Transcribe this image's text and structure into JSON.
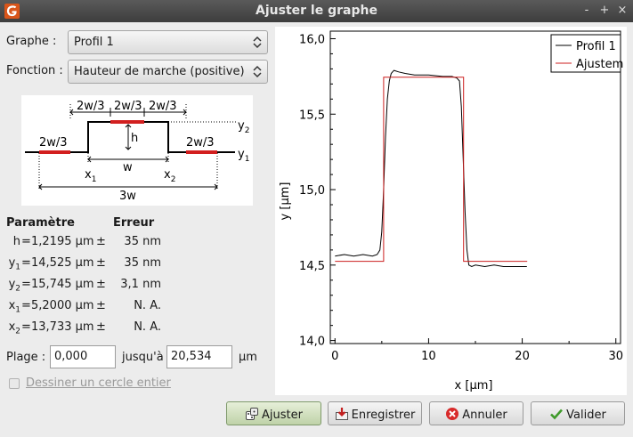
{
  "window": {
    "title": "Ajuster le graphe",
    "controls": [
      "-",
      "+",
      "×"
    ]
  },
  "form": {
    "graph_label": "Graphe :",
    "graph_value": "Profil 1",
    "function_label": "Fonction :",
    "function_value": "Hauteur de marche (positive)"
  },
  "diagram": {
    "labels": {
      "top_left": "2w/3",
      "top_mid": "2w/3",
      "top_right": "2w/3",
      "h": "h",
      "w": "w",
      "left_seg": "2w/3",
      "right_seg": "2w/3",
      "y2": "y",
      "y2_sub": "2",
      "y1": "y",
      "y1_sub": "1",
      "x1": "x",
      "x1_sub": "1",
      "x2": "x",
      "x2_sub": "2",
      "total": "3w"
    },
    "colors": {
      "line": "#000000",
      "highlight": "#d21f1f"
    }
  },
  "results": {
    "param_header": "Paramètre",
    "error_header": "Erreur",
    "rows": [
      {
        "name": "h",
        "sub": "",
        "eq": "=",
        "value": "1,2195 µm",
        "pm": "±",
        "error": "35 nm"
      },
      {
        "name": "y",
        "sub": "1",
        "eq": "=",
        "value": "14,525 µm",
        "pm": "±",
        "error": "35 nm"
      },
      {
        "name": "y",
        "sub": "2",
        "eq": "=",
        "value": "15,745 µm",
        "pm": "±",
        "error": "3,1 nm"
      },
      {
        "name": "x",
        "sub": "1",
        "eq": "=",
        "value": "5,2000 µm",
        "pm": "±",
        "error": "N. A."
      },
      {
        "name": "x",
        "sub": "2",
        "eq": "=",
        "value": "13,733 µm",
        "pm": "±",
        "error": "N. A."
      }
    ]
  },
  "range": {
    "label": "Plage :",
    "from": "0,000",
    "to_label": "jusqu'à",
    "to": "20,534",
    "unit": "µm"
  },
  "options": {
    "full_circle_label": "Dessiner un cercle entier",
    "full_circle_checked": false
  },
  "buttons": {
    "fit": "Ajuster",
    "save": "Enregistrer",
    "cancel": "Annuler",
    "ok": "Valider"
  },
  "chart_data": {
    "type": "line",
    "xlabel": "x [µm]",
    "ylabel": "y [µm]",
    "xlim": [
      -0.5,
      30.5
    ],
    "ylim": [
      13.98,
      16.05
    ],
    "xticks": [
      0,
      10,
      20,
      30
    ],
    "xtick_labels": [
      "0",
      "10",
      "20",
      "30"
    ],
    "yticks": [
      14.0,
      14.5,
      15.0,
      15.5,
      16.0
    ],
    "ytick_labels": [
      "14,0",
      "14,5",
      "15,0",
      "15,5",
      "16,0"
    ],
    "legend_position": "top-right",
    "series": [
      {
        "name": "Profil 1",
        "color": "#000000",
        "x": [
          0,
          1,
          2,
          3,
          4,
          4.5,
          4.8,
          5.0,
          5.2,
          5.4,
          5.6,
          5.8,
          6.0,
          6.3,
          6.8,
          7.5,
          8.5,
          10,
          11.5,
          12.5,
          13.0,
          13.3,
          13.5,
          13.7,
          13.9,
          14.1,
          14.3,
          14.6,
          15,
          16,
          17,
          18,
          19,
          20.5
        ],
        "y": [
          14.56,
          14.57,
          14.56,
          14.57,
          14.56,
          14.57,
          14.6,
          14.72,
          15.0,
          15.35,
          15.6,
          15.72,
          15.77,
          15.79,
          15.78,
          15.77,
          15.76,
          15.76,
          15.75,
          15.75,
          15.74,
          15.72,
          15.55,
          15.2,
          14.85,
          14.6,
          14.5,
          14.49,
          14.5,
          14.49,
          14.5,
          14.49,
          14.49,
          14.49
        ]
      },
      {
        "name": "Ajustem",
        "color": "#cc1f1f",
        "x": [
          0,
          5.2,
          5.2,
          13.733,
          13.733,
          20.534
        ],
        "y": [
          14.525,
          14.525,
          15.745,
          15.745,
          14.525,
          14.525
        ]
      }
    ]
  }
}
